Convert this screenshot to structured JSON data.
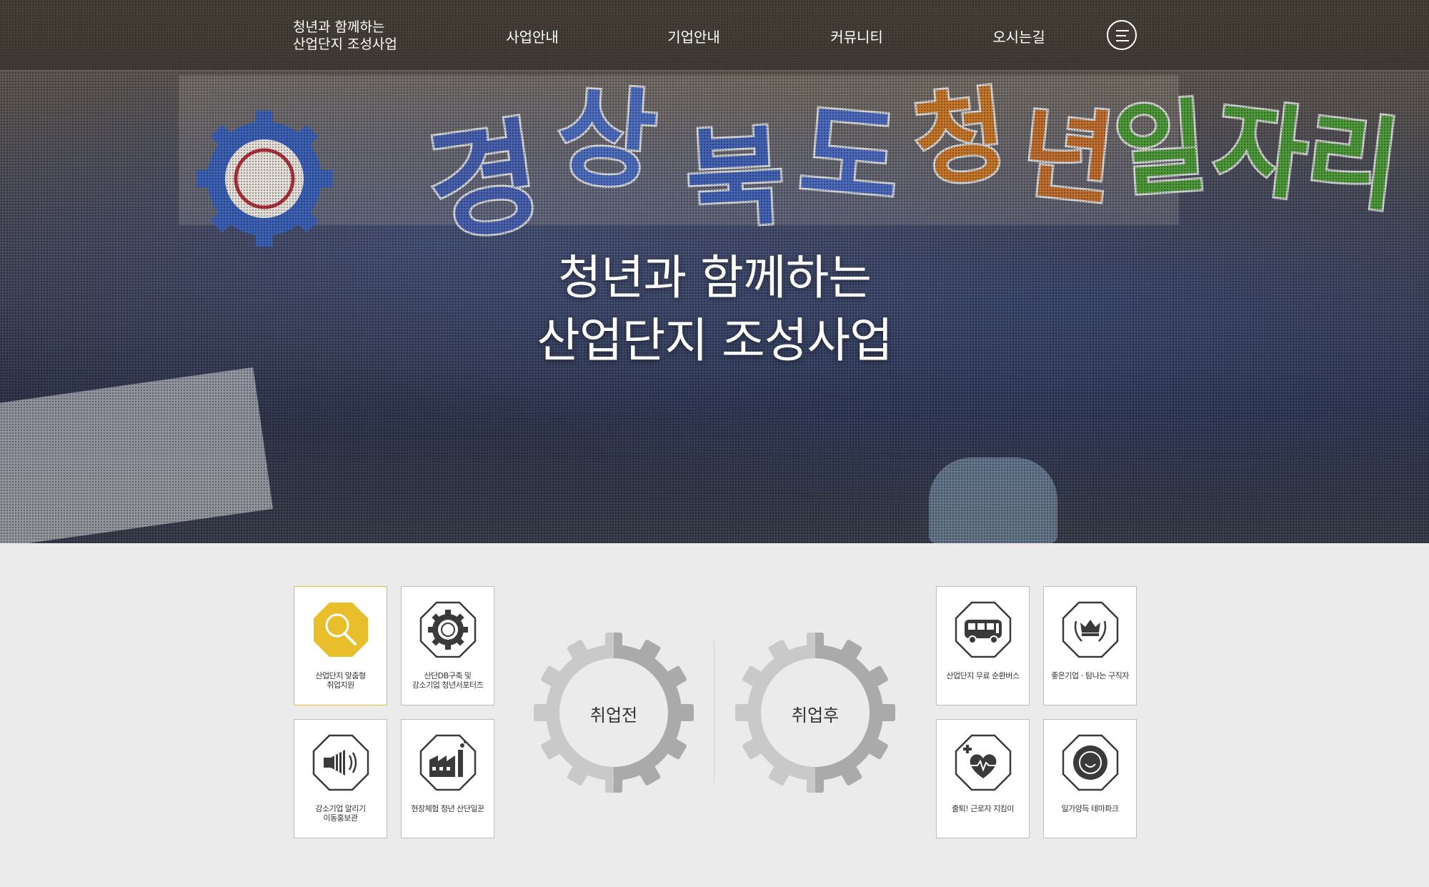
{
  "header": {
    "logo_line1": "청년과 함께하는",
    "logo_line2": "산업단지 조성사업",
    "nav": [
      "사업안내",
      "기업안내",
      "커뮤니티",
      "오시는길"
    ],
    "menu_icon": "hamburger-icon"
  },
  "hero": {
    "title_line1": "청년과 함께하는",
    "title_line2": "산업단지 조성사업"
  },
  "before_services": [
    {
      "label": "산업단지 맞춤형\n취업지원",
      "icon": "magnifier-icon",
      "active": true
    },
    {
      "label": "산단DB구축 및\n강소기업 청년서포터즈",
      "icon": "youth-gear-icon",
      "active": false
    },
    {
      "label": "강소기업 알리기\n이동홍보관",
      "icon": "loudspeaker-icon",
      "active": false
    },
    {
      "label": "현장체험 청년 산단일꾼",
      "icon": "factory-icon",
      "active": false
    }
  ],
  "gears": {
    "before": "취업전",
    "after": "취업후"
  },
  "after_services": [
    {
      "label": "산업단지 무료 순환버스",
      "icon": "bus-icon"
    },
    {
      "label": "좋은기업ㆍ탐나는 구직자",
      "icon": "crown-wreath-icon"
    },
    {
      "label": "출퇴! 근로자 지킴이",
      "icon": "heart-health-icon"
    },
    {
      "label": "일가양득 테마파크",
      "icon": "wlb-badge-icon"
    }
  ],
  "colors": {
    "accent": "#e8bf2a",
    "icon_dark": "#3a3a3a",
    "gear_light": "#c9c9c9",
    "gear_dark": "#aaaaaa"
  }
}
